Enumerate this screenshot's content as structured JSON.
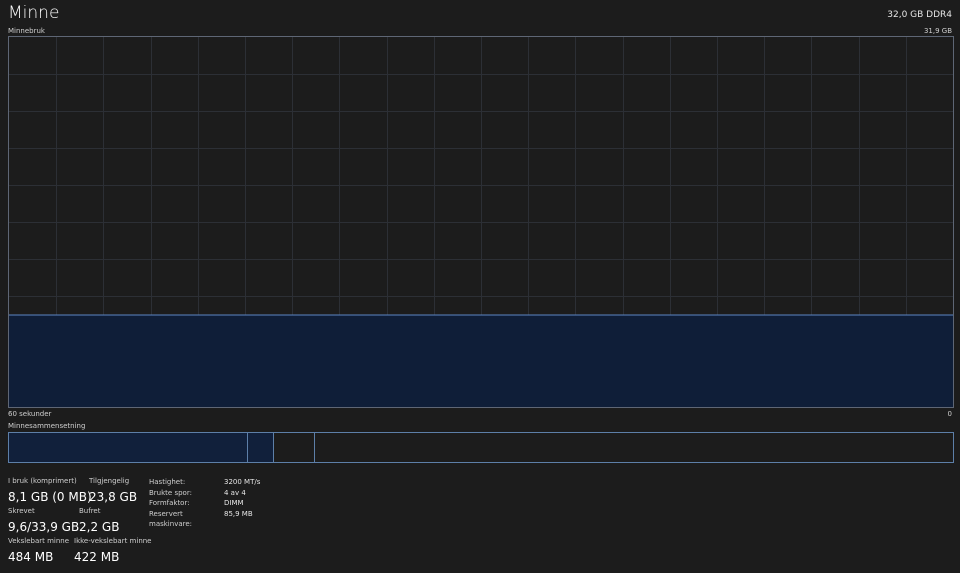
{
  "header": {
    "title": "Minne",
    "spec": "32,0 GB DDR4"
  },
  "graph": {
    "label": "Minnebruk",
    "max_label": "31,9 GB",
    "time_left": "60 sekunder",
    "time_right": "0",
    "usage_fraction": 0.25,
    "line_color": "#5d86c4",
    "fill_color": "#0f1e38",
    "grid_color": "#2c2f35"
  },
  "composition": {
    "label": "Minnesammensetning"
  },
  "stats": {
    "in_use": {
      "label": "I bruk (komprimert)",
      "value": "8,1 GB (0 MB)"
    },
    "available": {
      "label": "Tilgjengelig",
      "value": "23,8 GB"
    },
    "committed": {
      "label": "Skrevet",
      "value": "9,6/33,9 GB"
    },
    "cached": {
      "label": "Bufret",
      "value": "2,2 GB"
    },
    "paged_pool": {
      "label": "Vekslebart minne",
      "value": "484 MB"
    },
    "non_paged_pool": {
      "label": "Ikke-vekslebart minne",
      "value": "422 MB"
    }
  },
  "details": [
    {
      "key": "Hastighet:",
      "value": "3200 MT/s"
    },
    {
      "key": "Brukte spor:",
      "value": "4 av 4"
    },
    {
      "key": "Formfaktor:",
      "value": "DIMM"
    },
    {
      "key": "Reservert maskinvare:",
      "value": "85,9 MB"
    }
  ]
}
